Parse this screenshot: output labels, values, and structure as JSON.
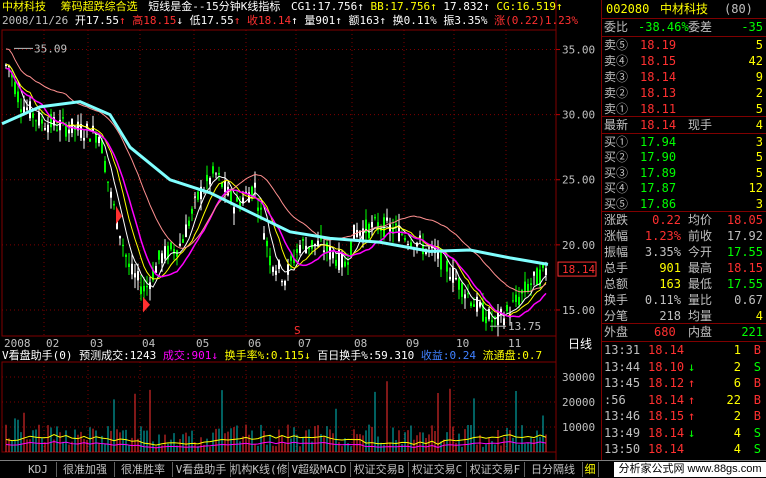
{
  "header": {
    "stock_name": "中材科技",
    "indicator_set": "筹码超跌综合选",
    "indicator_desc": "短线是金--15分钟K线指标",
    "cg1": "CG1:17.756",
    "bb": "BB:17.756",
    "bb2": "17.832",
    "cg": "CG:16.519",
    "date": "2008/11/26",
    "open": "开17.55",
    "high": "高18.15",
    "low": "低17.55",
    "close": "收18.14",
    "volume": "量901",
    "amount": "额163",
    "turnover": "换0.11%",
    "amplitude": "振3.35%",
    "change": "涨(0.22)1.23%"
  },
  "main_chart": {
    "price_ticks": [
      "35.00",
      "30.00",
      "25.00",
      "20.00",
      "15.00"
    ],
    "high_marker": "35.09",
    "low_marker": "13.75",
    "last_price_tag": "18.14",
    "month_labels": [
      "2008",
      "02",
      "03",
      "04",
      "05",
      "06",
      "07",
      "08",
      "09",
      "10",
      "11"
    ],
    "period": "日线",
    "s_marker": "S"
  },
  "sub_chart": {
    "title": "V看盘助手(0)",
    "forecast": "预测成交:1243",
    "volume": "成交:901",
    "turnover_rate": "换手率%:0.115",
    "hundred_day": "百日换手%:59.310",
    "profit": "收益:0.24",
    "float_cap": "流通盘:0.7",
    "vol_ticks": [
      "30000",
      "20000",
      "10000"
    ]
  },
  "quote_panel": {
    "code": "002080",
    "name": "中材科技",
    "seq": "(80)",
    "weibi_label": "委比",
    "weibi_value": "-38.46%",
    "weicha_label": "委差",
    "weicha_value": "-35",
    "asks": [
      {
        "label": "卖⑤",
        "price": "18.19",
        "vol": "5"
      },
      {
        "label": "卖④",
        "price": "18.15",
        "vol": "42"
      },
      {
        "label": "卖③",
        "price": "18.14",
        "vol": "9"
      },
      {
        "label": "卖②",
        "price": "18.13",
        "vol": "2"
      },
      {
        "label": "卖①",
        "price": "18.11",
        "vol": "5"
      }
    ],
    "latest_label": "最新",
    "latest_price": "18.14",
    "current_label": "现手",
    "current_vol": "4",
    "bids": [
      {
        "label": "买①",
        "price": "17.94",
        "vol": "3"
      },
      {
        "label": "买②",
        "price": "17.90",
        "vol": "5"
      },
      {
        "label": "买③",
        "price": "17.89",
        "vol": "5"
      },
      {
        "label": "买④",
        "price": "17.87",
        "vol": "12"
      },
      {
        "label": "买⑤",
        "price": "17.86",
        "vol": "3"
      }
    ],
    "stats": [
      {
        "l1": "涨跌",
        "v1": "0.22",
        "l2": "均价",
        "v2": "18.05"
      },
      {
        "l1": "涨幅",
        "v1": "1.23%",
        "l2": "前收",
        "v2": "17.92"
      },
      {
        "l1": "振幅",
        "v1": "3.35%",
        "l2": "今开",
        "v2": "17.55"
      },
      {
        "l1": "总手",
        "v1": "901",
        "l2": "最高",
        "v2": "18.15"
      },
      {
        "l1": "总额",
        "v1": "163",
        "l2": "最低",
        "v2": "17.55"
      },
      {
        "l1": "换手",
        "v1": "0.11%",
        "l2": "量比",
        "v2": "0.67"
      },
      {
        "l1": "分笔",
        "v1": "218",
        "l2": "均量",
        "v2": "4"
      }
    ],
    "outer_label": "外盘",
    "outer_value": "680",
    "inner_label": "内盘",
    "inner_value": "221",
    "ticks": [
      {
        "time": "13:31",
        "price": "18.14",
        "arrow": "",
        "vol": "1",
        "side": "B"
      },
      {
        "time": "13:44",
        "price": "18.10",
        "arrow": "↓",
        "vol": "2",
        "side": "S"
      },
      {
        "time": "13:45",
        "price": "18.12",
        "arrow": "↑",
        "vol": "6",
        "side": "B"
      },
      {
        "time": ":56",
        "price": "18.14",
        "arrow": "↑",
        "vol": "22",
        "side": "B"
      },
      {
        "time": "13:46",
        "price": "18.15",
        "arrow": "↑",
        "vol": "2",
        "side": "B"
      },
      {
        "time": "13:49",
        "price": "18.14",
        "arrow": "↓",
        "vol": "4",
        "side": "S"
      },
      {
        "time": "13:50",
        "price": "18.14",
        "arrow": "",
        "vol": "4",
        "side": "S"
      }
    ]
  },
  "bottom_tabs": [
    "KDJ",
    "很准加强",
    "很准胜率",
    "V看盘助手",
    "机构K线(修",
    "V超级MACD",
    "权证交易B",
    "权证交易C",
    "权证交易F",
    "日分隔线",
    "细"
  ],
  "banner": "分析家公式网 www.88gs.com",
  "colors": {
    "up": "#ff3030",
    "down": "#00ff00",
    "yellow": "#ffff00",
    "cyan": "#80ffff",
    "magenta": "#ff00ff",
    "white": "#ffffff",
    "grid_red": "#800000"
  }
}
